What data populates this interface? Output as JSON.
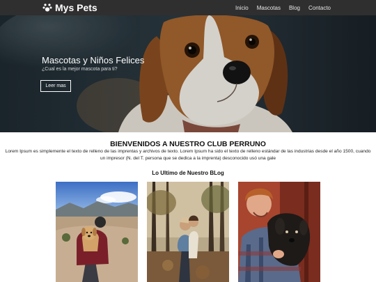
{
  "navbar": {
    "brand": "Mys Pets",
    "links": [
      "Inicio",
      "Mascotas",
      "Blog",
      "Contacto"
    ]
  },
  "hero": {
    "title": "Mascotas y Niños Felices",
    "subtitle": "¿Cual es la mejor mascota para ti?",
    "button": "Leer mas"
  },
  "welcome": {
    "title": "BIENVENIDOS A NUESTRO CLUB PERRUNO",
    "text": "Lorem Ipsum es simplemente el texto de relleno de las imprentas y archivos de texto. Lorem Ipsum ha sido el texto de relleno estándar de las industrias desde el año 1500, cuando un impresor (N. del T. persona que se dedica a la imprenta) desconocido usó una gale"
  },
  "blog": {
    "title": "Lo Ultimo de Nuestro BLog",
    "posts": [
      {
        "image": "hiker-with-dog-backpack-photo"
      },
      {
        "image": "couple-in-forest-photo"
      },
      {
        "image": "man-hugging-dog-photo"
      }
    ]
  },
  "colors": {
    "navbar": "#2f2f2f",
    "hero_bg": "#24313a"
  }
}
